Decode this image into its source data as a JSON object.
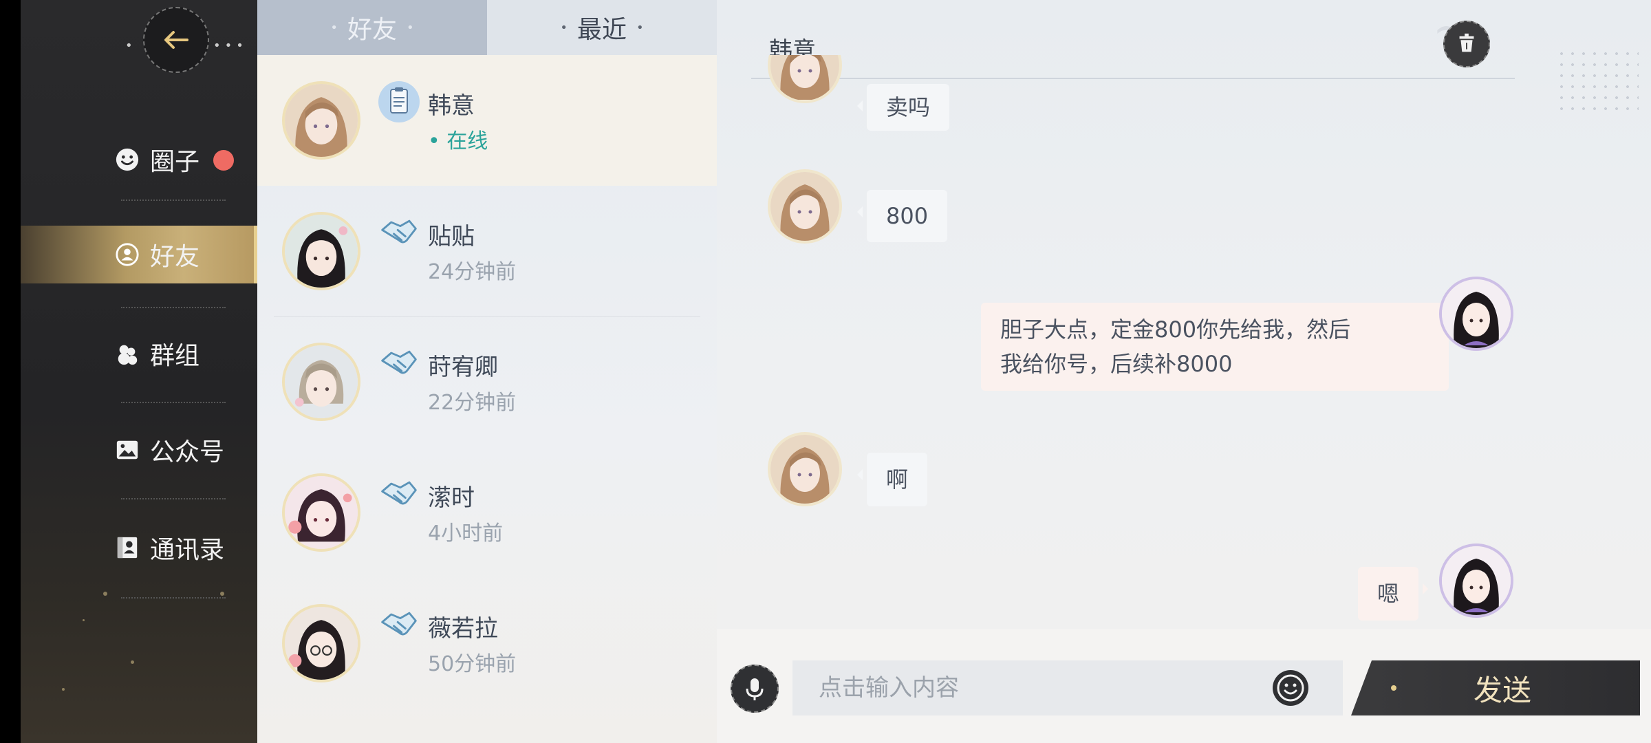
{
  "nav": {
    "items": [
      {
        "label": "圈子",
        "icon": "smiley-icon",
        "badge": true
      },
      {
        "label": "好友",
        "icon": "friend-icon",
        "active": true
      },
      {
        "label": "群组",
        "icon": "group-icon"
      },
      {
        "label": "公众号",
        "icon": "picture-icon"
      },
      {
        "label": "通讯录",
        "icon": "contacts-icon"
      }
    ]
  },
  "tabs": [
    {
      "label": "好友",
      "active": true
    },
    {
      "label": "最近",
      "active": false
    }
  ],
  "friends": [
    {
      "name": "韩意",
      "status": "在线",
      "online": true,
      "icon": "notes-icon"
    },
    {
      "name": "贴贴",
      "status": "24分钟前",
      "icon": "handshake-icon"
    },
    {
      "name": "莳宥卿",
      "status": "22分钟前",
      "icon": "handshake-icon"
    },
    {
      "name": "潆时",
      "status": "4小时前",
      "icon": "handshake-icon"
    },
    {
      "name": "薇若拉",
      "status": "50分钟前",
      "icon": "handshake-icon"
    }
  ],
  "chat": {
    "title": "韩意",
    "messages": [
      {
        "from": "other",
        "text": "卖吗"
      },
      {
        "from": "other",
        "text": "800"
      },
      {
        "from": "me",
        "lines": [
          "胆子大点，定金800你先给我，然后",
          "我给你号，后续补8000"
        ]
      },
      {
        "from": "other",
        "text": "啊"
      },
      {
        "from": "me",
        "text": "嗯"
      }
    ]
  },
  "input": {
    "placeholder": "点击输入内容",
    "send_label": "发送"
  },
  "colors": {
    "accent_gold": "#c9b079",
    "online_green": "#2aa39a",
    "badge_red": "#ef6b63"
  }
}
